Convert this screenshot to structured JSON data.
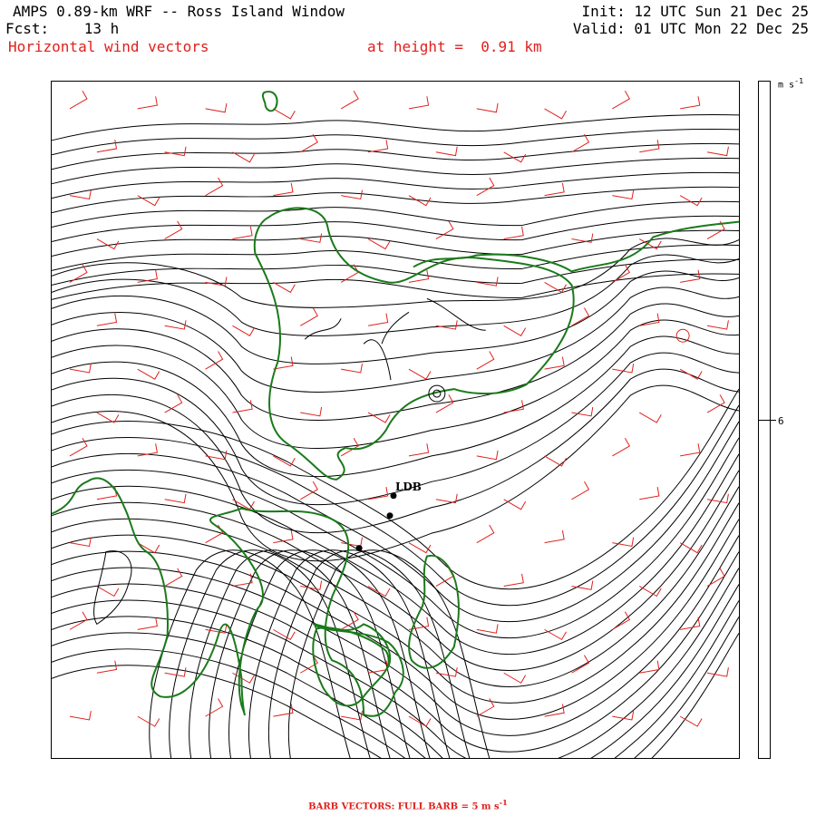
{
  "header": {
    "title": "AMPS 0.89-km WRF -- Ross Island Window",
    "forecast": "Fcst:    13 h",
    "subtitle": "Horizontal wind vectors",
    "height_label": "at height =  0.91 km",
    "init": "Init: 12 UTC Sun 21 Dec 25",
    "valid": "Valid: 01 UTC Mon 22 Dec 25"
  },
  "map": {
    "stations": [
      {
        "label": "LDB"
      }
    ],
    "colors": {
      "streamlines": "#000000",
      "barbs": "#e0201c",
      "coastline": "#1a7a1a"
    }
  },
  "scale": {
    "units_base": "m s",
    "units_exp": "-1",
    "tick_value": "6"
  },
  "footer": {
    "text": "BARB VECTORS:  FULL BARB = 5 m s",
    "exp": "-1"
  }
}
